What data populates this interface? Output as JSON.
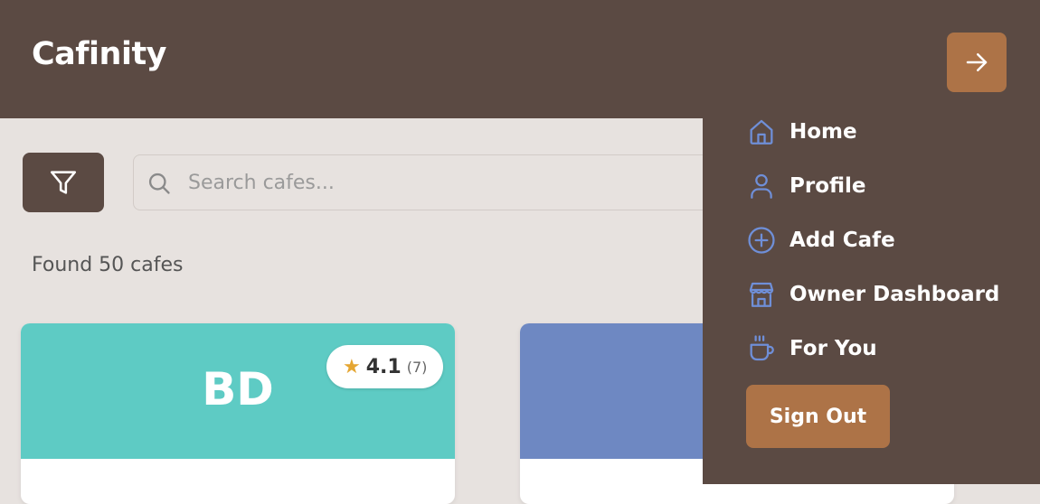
{
  "header": {
    "title": "Cafinity",
    "toggle_icon": "arrow-right-icon"
  },
  "search": {
    "placeholder": "Search cafes...",
    "value": "",
    "filter_icon": "filter-icon",
    "search_icon": "search-icon"
  },
  "results": {
    "count_text": "Found 50 cafes"
  },
  "cards": [
    {
      "initials": "BD",
      "banner_color": "#5ecbc4",
      "rating": "4.1",
      "review_count": "(7)"
    },
    {
      "banner_color": "#6e88c2"
    }
  ],
  "menu": {
    "items": [
      {
        "label": "Home",
        "icon": "home-icon"
      },
      {
        "label": "Profile",
        "icon": "user-icon"
      },
      {
        "label": "Add Cafe",
        "icon": "plus-circle-icon"
      },
      {
        "label": "Owner Dashboard",
        "icon": "store-icon"
      },
      {
        "label": "For You",
        "icon": "coffee-cup-icon"
      }
    ],
    "sign_out_label": "Sign Out"
  },
  "colors": {
    "header_bg": "#5b4a43",
    "accent": "#ad7347",
    "page_bg": "#e7e2df",
    "menu_icon": "#6f8fd8",
    "star": "#e5a632"
  }
}
